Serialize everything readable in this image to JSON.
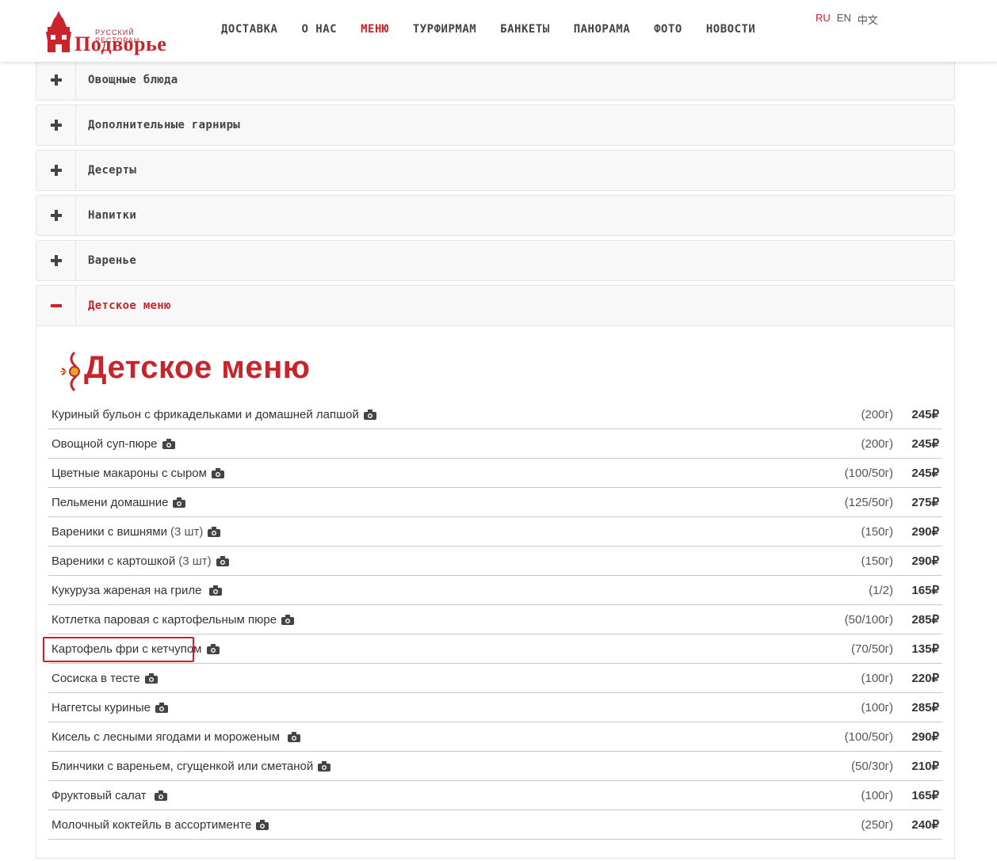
{
  "header": {
    "logo": {
      "subtitle": "Русский ресторан",
      "name": "Подворье"
    },
    "nav": [
      {
        "label": "ДОСТАВКА",
        "active": false
      },
      {
        "label": "О НАС",
        "active": false
      },
      {
        "label": "МЕНЮ",
        "active": true
      },
      {
        "label": "ТУРФИРМАМ",
        "active": false
      },
      {
        "label": "БАНКЕТЫ",
        "active": false
      },
      {
        "label": "ПАНОРАМА",
        "active": false
      },
      {
        "label": "ФОТО",
        "active": false
      },
      {
        "label": "НОВОСТИ",
        "active": false
      }
    ],
    "languages": [
      {
        "label": "RU",
        "active": true
      },
      {
        "label": "EN",
        "active": false
      },
      {
        "label": "中文",
        "active": false
      }
    ]
  },
  "accordion": [
    {
      "title": "Овощные блюда",
      "open": false
    },
    {
      "title": "Дополнительные гарниры",
      "open": false
    },
    {
      "title": "Десерты",
      "open": false
    },
    {
      "title": "Напитки",
      "open": false
    },
    {
      "title": "Варенье",
      "open": false
    },
    {
      "title": "Детское меню",
      "open": true
    }
  ],
  "section": {
    "title": "Детское меню",
    "items": [
      {
        "name": "Куриный бульон с фрикадельками и домашней лапшой",
        "qty": "",
        "weight": "(200г)",
        "price": "245₽"
      },
      {
        "name": "Овощной суп-пюре",
        "qty": "",
        "weight": "(200г)",
        "price": "245₽"
      },
      {
        "name": "Цветные макароны с сыром",
        "qty": "",
        "weight": "(100/50г)",
        "price": "245₽"
      },
      {
        "name": "Пельмени домашние",
        "qty": "",
        "weight": "(125/50г)",
        "price": "275₽"
      },
      {
        "name": "Вареники с вишнями",
        "qty": "(3 шт)",
        "weight": "(150г)",
        "price": "290₽"
      },
      {
        "name": "Вареники с картошкой",
        "qty": "(3 шт)",
        "weight": "(150г)",
        "price": "290₽"
      },
      {
        "name": "Кукуруза жареная на гриле",
        "qty": "",
        "weight": "(1/2)",
        "price": "165₽"
      },
      {
        "name": "Котлетка паровая с картофельным пюре",
        "qty": "",
        "weight": "(50/100г)",
        "price": "285₽"
      },
      {
        "name": "Картофель фри с кетчупом",
        "qty": "",
        "weight": "(70/50г)",
        "price": "135₽"
      },
      {
        "name": "Сосиска в тесте",
        "qty": "",
        "weight": "(100г)",
        "price": "220₽"
      },
      {
        "name": "Наггетсы куриные",
        "qty": "",
        "weight": "(100г)",
        "price": "285₽"
      },
      {
        "name": "Кисель с лесными ягодами и мороженым",
        "qty": "",
        "weight": "(100/50г)",
        "price": "290₽"
      },
      {
        "name": "Блинчики с вареньем, сгущенкой или сметаной",
        "qty": "",
        "weight": "(50/30г)",
        "price": "210₽"
      },
      {
        "name": "Фруктовый салат",
        "qty": "",
        "weight": "(100г)",
        "price": "165₽"
      },
      {
        "name": "Молочный коктейль в ассортименте",
        "qty": "",
        "weight": "(250г)",
        "price": "240₽"
      }
    ]
  },
  "icons": {
    "item_photo": "camera-icon",
    "expand": "plus-icon",
    "collapse": "minus-icon"
  },
  "colors": {
    "accent": "#c9232b",
    "highlight": "#e0141e"
  }
}
